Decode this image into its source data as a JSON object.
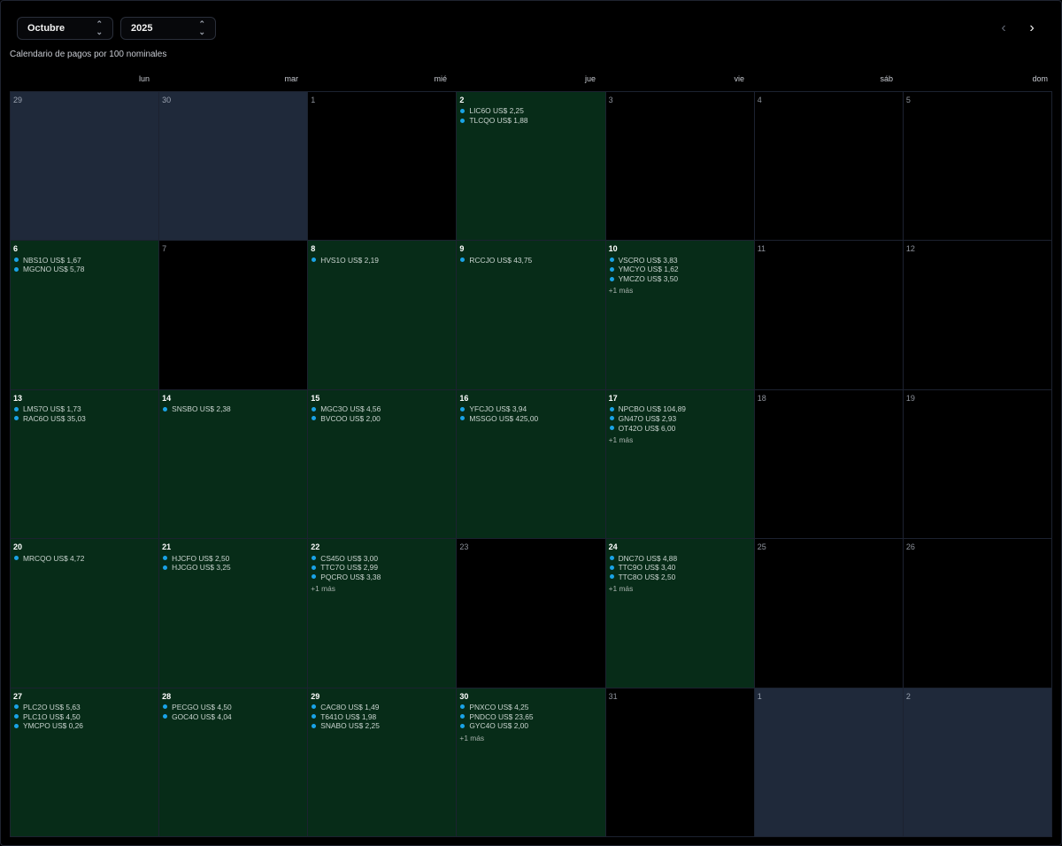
{
  "header": {
    "month": "Octubre",
    "year": "2025",
    "subtitle": "Calendario de pagos por 100 nominales",
    "prev_icon": "chevron-left-icon",
    "next_icon": "chevron-right-icon"
  },
  "weekdays": [
    "lun",
    "mar",
    "mié",
    "jue",
    "vie",
    "sáb",
    "dom"
  ],
  "colors": {
    "payment_day_bg": "#072c18",
    "other_month_bg": "#1f293a",
    "empty_day_bg": "#000000",
    "dot": "#1aa3e6"
  },
  "days": [
    {
      "label": "29",
      "type": "other",
      "payments": []
    },
    {
      "label": "30",
      "type": "other",
      "payments": []
    },
    {
      "label": "1",
      "type": "empty",
      "payments": []
    },
    {
      "label": "2",
      "type": "pay",
      "payments": [
        "LIC6O US$ 2,25",
        "TLCQO US$ 1,88"
      ]
    },
    {
      "label": "3",
      "type": "empty",
      "payments": []
    },
    {
      "label": "4",
      "type": "empty",
      "payments": []
    },
    {
      "label": "5",
      "type": "empty",
      "payments": []
    },
    {
      "label": "6",
      "type": "pay",
      "payments": [
        "NBS1O US$ 1,67",
        "MGCNO US$ 5,78"
      ]
    },
    {
      "label": "7",
      "type": "empty",
      "payments": []
    },
    {
      "label": "8",
      "type": "pay",
      "payments": [
        "HVS1O US$ 2,19"
      ]
    },
    {
      "label": "9",
      "type": "pay",
      "payments": [
        "RCCJO US$ 43,75"
      ]
    },
    {
      "label": "10",
      "type": "pay",
      "payments": [
        "VSCRO US$ 3,83",
        "YMCYO US$ 1,62",
        "YMCZO US$ 3,50"
      ],
      "more": "+1 más"
    },
    {
      "label": "11",
      "type": "empty",
      "payments": []
    },
    {
      "label": "12",
      "type": "empty",
      "payments": []
    },
    {
      "label": "13",
      "type": "pay",
      "payments": [
        "LMS7O US$ 1,73",
        "RAC6O US$ 35,03"
      ]
    },
    {
      "label": "14",
      "type": "pay",
      "payments": [
        "SNSBO US$ 2,38"
      ]
    },
    {
      "label": "15",
      "type": "pay",
      "payments": [
        "MGC3O US$ 4,56",
        "BVCOO US$ 2,00"
      ]
    },
    {
      "label": "16",
      "type": "pay",
      "payments": [
        "YFCJO US$ 3,94",
        "MSSGO US$ 425,00"
      ]
    },
    {
      "label": "17",
      "type": "pay",
      "payments": [
        "NPCBO US$ 104,89",
        "GN47O US$ 2,93",
        "OT42O US$ 6,00"
      ],
      "more": "+1 más"
    },
    {
      "label": "18",
      "type": "empty",
      "payments": []
    },
    {
      "label": "19",
      "type": "empty",
      "payments": []
    },
    {
      "label": "20",
      "type": "pay",
      "payments": [
        "MRCQO US$ 4,72"
      ]
    },
    {
      "label": "21",
      "type": "pay",
      "payments": [
        "HJCFO US$ 2,50",
        "HJCGO US$ 3,25"
      ]
    },
    {
      "label": "22",
      "type": "pay",
      "payments": [
        "CS45O US$ 3,00",
        "TTC7O US$ 2,99",
        "PQCRO US$ 3,38"
      ],
      "more": "+1 más"
    },
    {
      "label": "23",
      "type": "empty",
      "payments": []
    },
    {
      "label": "24",
      "type": "pay",
      "payments": [
        "DNC7O US$ 4,88",
        "TTC9O US$ 3,40",
        "TTC8O US$ 2,50"
      ],
      "more": "+1 más"
    },
    {
      "label": "25",
      "type": "empty",
      "payments": []
    },
    {
      "label": "26",
      "type": "empty",
      "payments": []
    },
    {
      "label": "27",
      "type": "pay",
      "payments": [
        "PLC2O US$ 5,63",
        "PLC1O US$ 4,50",
        "YMCPO US$ 0,26"
      ]
    },
    {
      "label": "28",
      "type": "pay",
      "payments": [
        "PECGO US$ 4,50",
        "GOC4O US$ 4,04"
      ]
    },
    {
      "label": "29",
      "type": "pay",
      "payments": [
        "CAC8O US$ 1,49",
        "T641O US$ 1,98",
        "SNABO US$ 2,25"
      ]
    },
    {
      "label": "30",
      "type": "pay",
      "payments": [
        "PNXCO US$ 4,25",
        "PNDCO US$ 23,65",
        "GYC4O US$ 2,00"
      ],
      "more": "+1 más"
    },
    {
      "label": "31",
      "type": "empty",
      "payments": []
    },
    {
      "label": "1",
      "type": "other",
      "payments": []
    },
    {
      "label": "2",
      "type": "other",
      "payments": []
    }
  ]
}
